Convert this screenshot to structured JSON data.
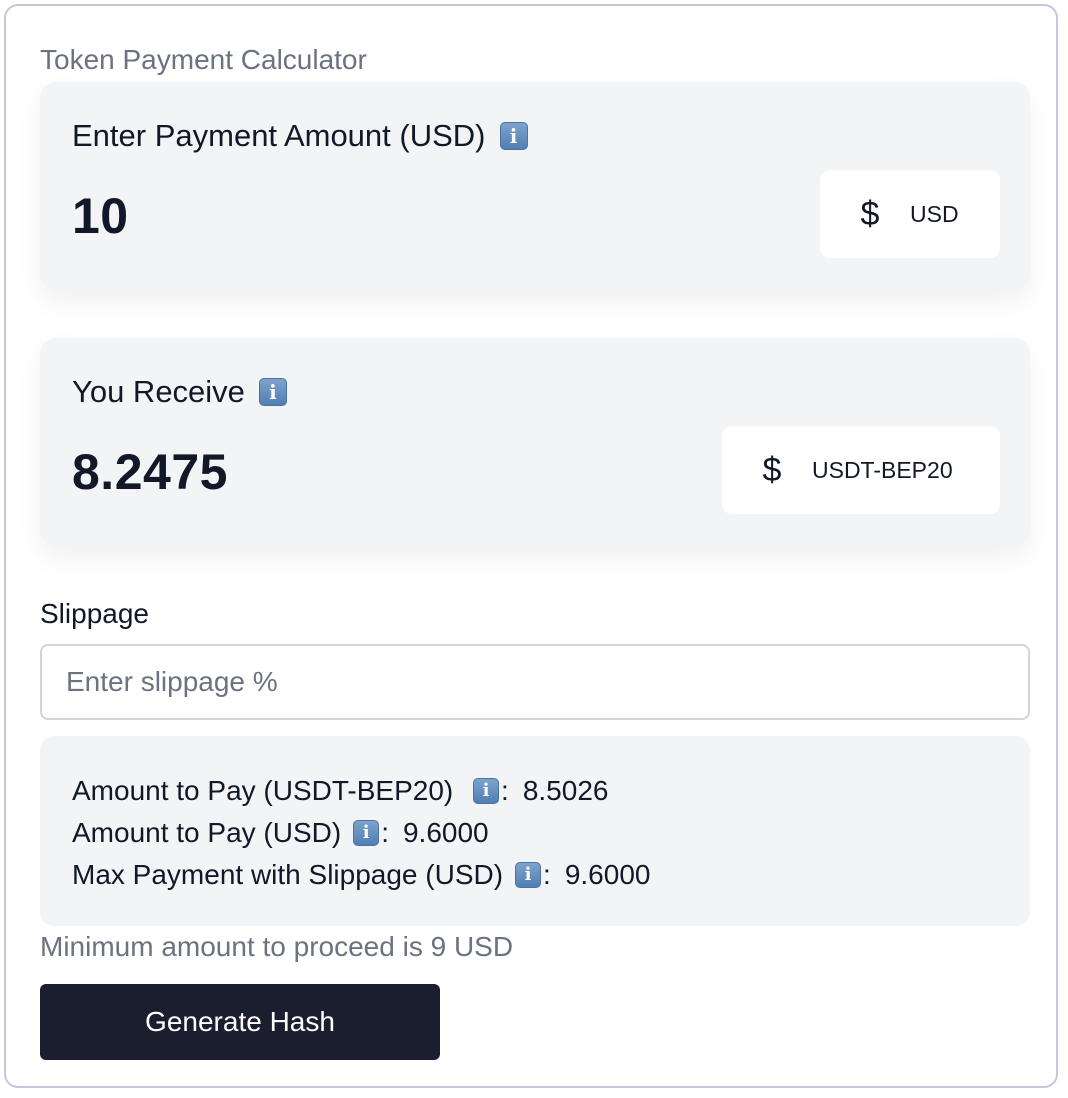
{
  "calculator": {
    "title": "Token Payment Calculator"
  },
  "pay_panel": {
    "label": "Enter Payment Amount (USD)",
    "value": "10",
    "currency_symbol": "$",
    "currency": "USD"
  },
  "receive_panel": {
    "label": "You Receive",
    "value": "8.2475",
    "currency_symbol": "$",
    "currency": "USDT-BEP20"
  },
  "slippage": {
    "label": "Slippage",
    "placeholder": "Enter slippage %",
    "value": ""
  },
  "summary": {
    "rows": [
      {
        "label": "Amount to Pay (USDT-BEP20) ",
        "value": "8.5026"
      },
      {
        "label": "Amount to Pay (USD)",
        "value": "9.6000"
      },
      {
        "label": "Max Payment with Slippage (USD)",
        "value": "9.6000"
      }
    ]
  },
  "minimum_note": "Minimum amount to proceed is 9 USD",
  "generate_button": {
    "label": "Generate Hash"
  },
  "icons": {
    "info": "information-icon",
    "currency": "dollar-icon",
    "info_glyph": "i"
  },
  "colors": {
    "button_bg": "#1b1e2e",
    "panel_bg": "#f3f4f6",
    "border": "#c8c6dc",
    "muted_text": "#6b7280"
  }
}
